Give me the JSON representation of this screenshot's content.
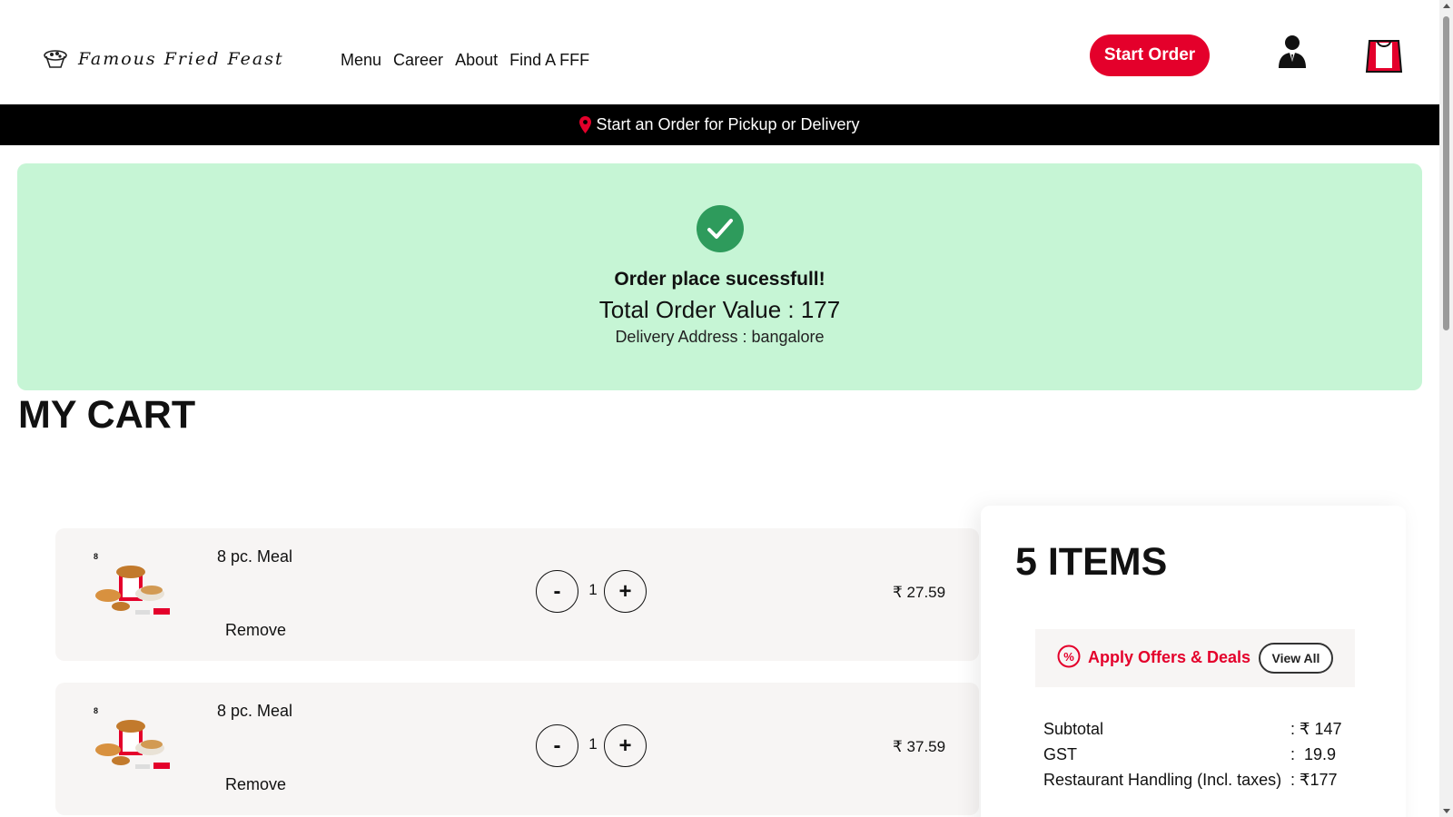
{
  "brand": {
    "name": "Famous Fried Feast",
    "accent": "#e4002b"
  },
  "nav": {
    "items": [
      "Menu",
      "Career",
      "About",
      "Find A FFF"
    ]
  },
  "header": {
    "start_order": "Start Order",
    "user_icon": "user-icon",
    "cart_icon": "shopping-bag-icon"
  },
  "delivery_bar": {
    "text": "Start an Order for Pickup or Delivery",
    "icon": "location-pin-icon"
  },
  "success": {
    "icon": "check-circle-icon",
    "title": "Order place sucessfull!",
    "total": "Total Order Value : 177",
    "address": "Delivery Address : bangalore",
    "background": "#c6f5d5"
  },
  "cart": {
    "heading": "MY CART",
    "items": [
      {
        "name": "8 pc. Meal",
        "quantity": "1",
        "price": "₹ 27.59",
        "remove": "Remove",
        "minus": "-",
        "plus": "+",
        "image_badge": "8"
      },
      {
        "name": "8 pc. Meal",
        "quantity": "1",
        "price": "₹ 37.59",
        "remove": "Remove",
        "minus": "-",
        "plus": "+",
        "image_badge": "8"
      }
    ]
  },
  "summary": {
    "count": "5 ITEMS",
    "offers_label": "Apply Offers & Deals",
    "view_all": "View All",
    "rows": [
      {
        "label": "Subtotal",
        "value": ": ₹ 147"
      },
      {
        "label": "GST",
        "value": ":  19.9"
      },
      {
        "label": "Restaurant Handling (Incl. taxes)",
        "value": ": ₹177"
      }
    ]
  }
}
